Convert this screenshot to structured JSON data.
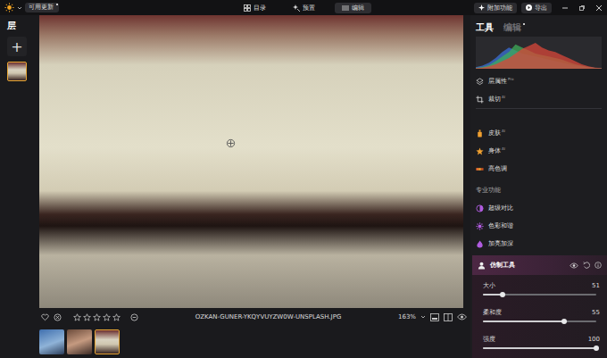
{
  "topbar": {
    "update_badge": {
      "label": "可用更新",
      "new": true
    },
    "nav": [
      {
        "label": "目录",
        "selected": false
      },
      {
        "label": "预置",
        "selected": false
      },
      {
        "label": "编辑",
        "selected": true
      }
    ],
    "actions": [
      {
        "label": "附加功能"
      },
      {
        "label": "导出"
      }
    ]
  },
  "layers": {
    "title": "层",
    "add": "+",
    "items": [
      {
        "selected": true
      }
    ]
  },
  "photo_info": {
    "favorite": false,
    "rejected": false,
    "stars": 0,
    "max_stars": 5,
    "filename": "OZKAN-GUNER-YKQYVUYZW0W-UNSPLASH.JPG",
    "zoom": "163%"
  },
  "filmstrip": [
    {
      "selected": false
    },
    {
      "selected": false
    },
    {
      "selected": true
    }
  ],
  "panel": {
    "tabs": [
      {
        "label": "工具",
        "selected": true,
        "modified": false
      },
      {
        "label": "编辑",
        "selected": false,
        "modified": true
      }
    ],
    "histogram": {
      "series": [
        {
          "name": "blue",
          "color": "#3b6fd8",
          "values": [
            0.05,
            0.1,
            0.2,
            0.35,
            0.55,
            0.7,
            0.6,
            0.5,
            0.45,
            0.4,
            0.35,
            0.3,
            0.25,
            0.2,
            0.15,
            0.1,
            0.08,
            0.05,
            0.03,
            0.02
          ]
        },
        {
          "name": "green",
          "color": "#3fae5a",
          "values": [
            0.03,
            0.06,
            0.12,
            0.25,
            0.4,
            0.55,
            0.8,
            0.7,
            0.6,
            0.5,
            0.45,
            0.4,
            0.35,
            0.3,
            0.22,
            0.15,
            0.1,
            0.06,
            0.03,
            0.02
          ]
        },
        {
          "name": "red",
          "color": "#d9473a",
          "values": [
            0.02,
            0.04,
            0.08,
            0.15,
            0.25,
            0.35,
            0.5,
            0.65,
            0.75,
            0.85,
            0.7,
            0.6,
            0.55,
            0.45,
            0.35,
            0.25,
            0.15,
            0.08,
            0.04,
            0.02
          ]
        }
      ]
    },
    "tools_top": [
      {
        "label": "层属性",
        "badge": "Pro"
      },
      {
        "label": "裁切",
        "badge": "AI"
      }
    ],
    "tools_ai": [
      {
        "label": "皮肤",
        "badge": "AI"
      },
      {
        "label": "身体",
        "badge": "AI"
      },
      {
        "label": "高色调",
        "badge": ""
      }
    ],
    "pro_section": {
      "title": "专业功能",
      "items": [
        {
          "label": "超级对比"
        },
        {
          "label": "色彩和谐"
        },
        {
          "label": "加亮加深"
        }
      ]
    },
    "active_tool": {
      "label": "仿制工具",
      "expanded": true,
      "sliders": [
        {
          "label": "大小",
          "value": "51",
          "level": 0.17
        },
        {
          "label": "柔和度",
          "value": "55",
          "level": 0.72
        },
        {
          "label": "强度",
          "value": "100",
          "level": 1.0
        }
      ]
    }
  }
}
